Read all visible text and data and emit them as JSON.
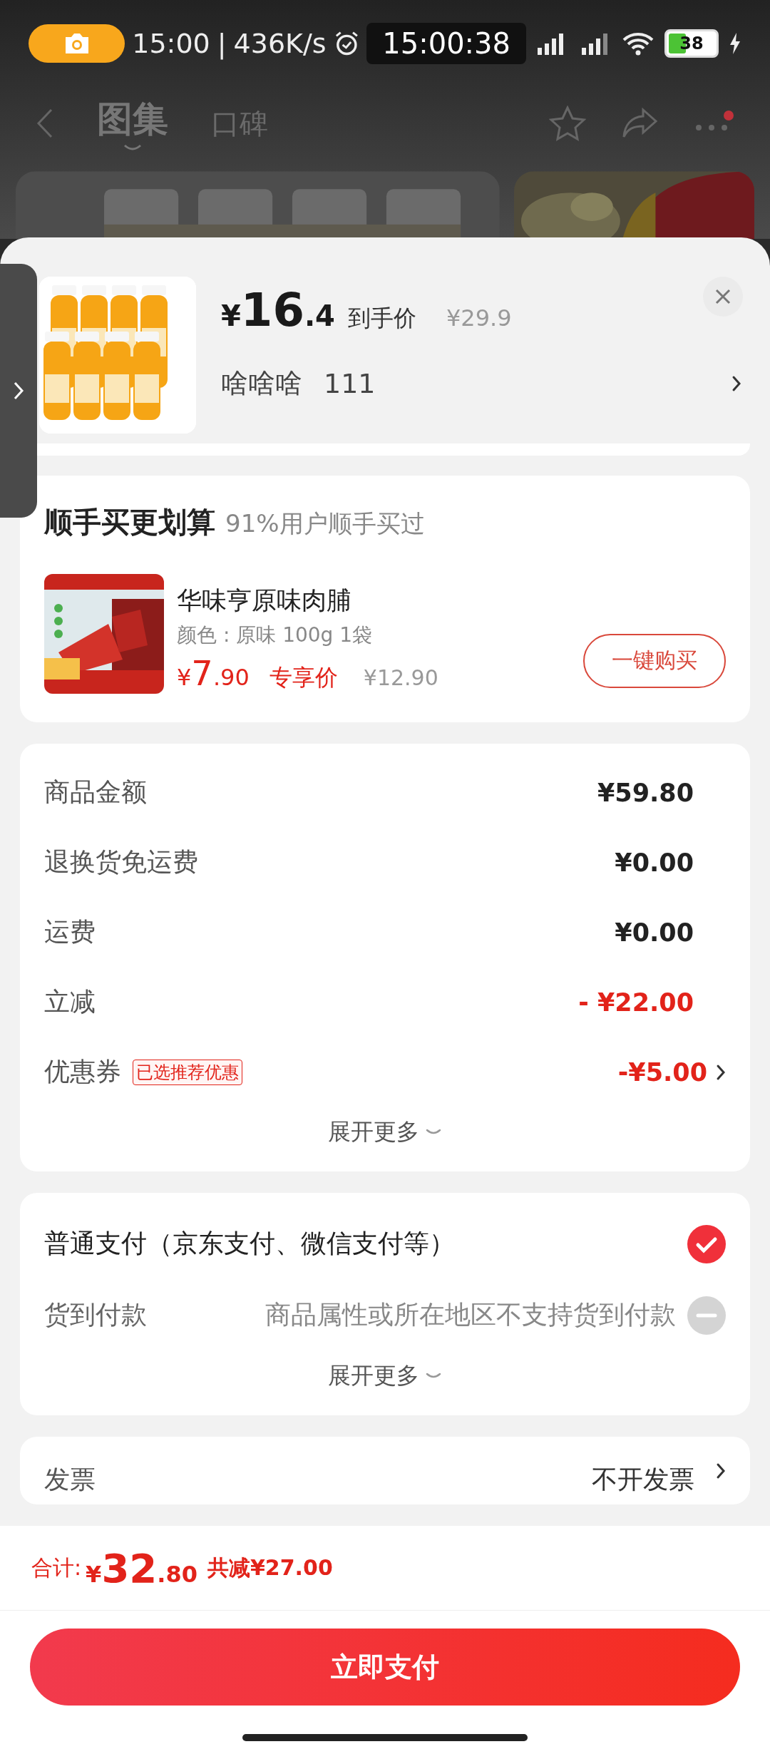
{
  "status_bar": {
    "time": "15:00",
    "separator": "|",
    "speed": "436K/s",
    "clock": "15:00:38",
    "battery": "38"
  },
  "nav": {
    "tabs": [
      {
        "label": "图集",
        "selected": true
      },
      {
        "label": "口碑",
        "selected": false
      }
    ],
    "notification_dot": true
  },
  "product": {
    "currency": "¥",
    "price_int": "16",
    "price_dec": ".4",
    "price_label": "到手价",
    "original_price": "¥29.9",
    "variant": "啥啥啥",
    "quantity": "111"
  },
  "addon": {
    "title": "顺手买更划算",
    "subtitle": "91%用户顺手买过",
    "item": {
      "name": "华味亨原味肉脯",
      "spec": "颜色 : 原味 100g 1袋",
      "currency": "¥",
      "price_int": "7",
      "price_dec": ".90",
      "price_label": "专享价",
      "original_price": "¥12.90",
      "button": "一键购买"
    }
  },
  "fees": {
    "rows": [
      {
        "kind": "plain",
        "label": "商品金额",
        "value": "¥59.80"
      },
      {
        "kind": "plain",
        "label": "退换货免运费",
        "value": "¥0.00"
      },
      {
        "kind": "plain",
        "label": "运费",
        "value": "¥0.00"
      },
      {
        "kind": "discount",
        "label": "立减",
        "value": "- ¥22.00"
      },
      {
        "kind": "coupon",
        "label": "优惠券",
        "tag": "已选推荐优惠",
        "value": "-¥5.00"
      }
    ],
    "expand": "展开更多"
  },
  "payment": {
    "options": [
      {
        "label": "普通支付（京东支付、微信支付等）",
        "selected": true,
        "disabled": false
      },
      {
        "label": "货到付款",
        "note": "商品属性或所在地区不支持货到付款",
        "selected": false,
        "disabled": true
      }
    ],
    "expand": "展开更多"
  },
  "invoice": {
    "label": "发票",
    "value": "不开发票"
  },
  "footer": {
    "total_label": "合计:",
    "currency": "¥",
    "total_int": "32",
    "total_dec": ".80",
    "saving": "共减¥27.00",
    "pay_button": "立即支付"
  }
}
